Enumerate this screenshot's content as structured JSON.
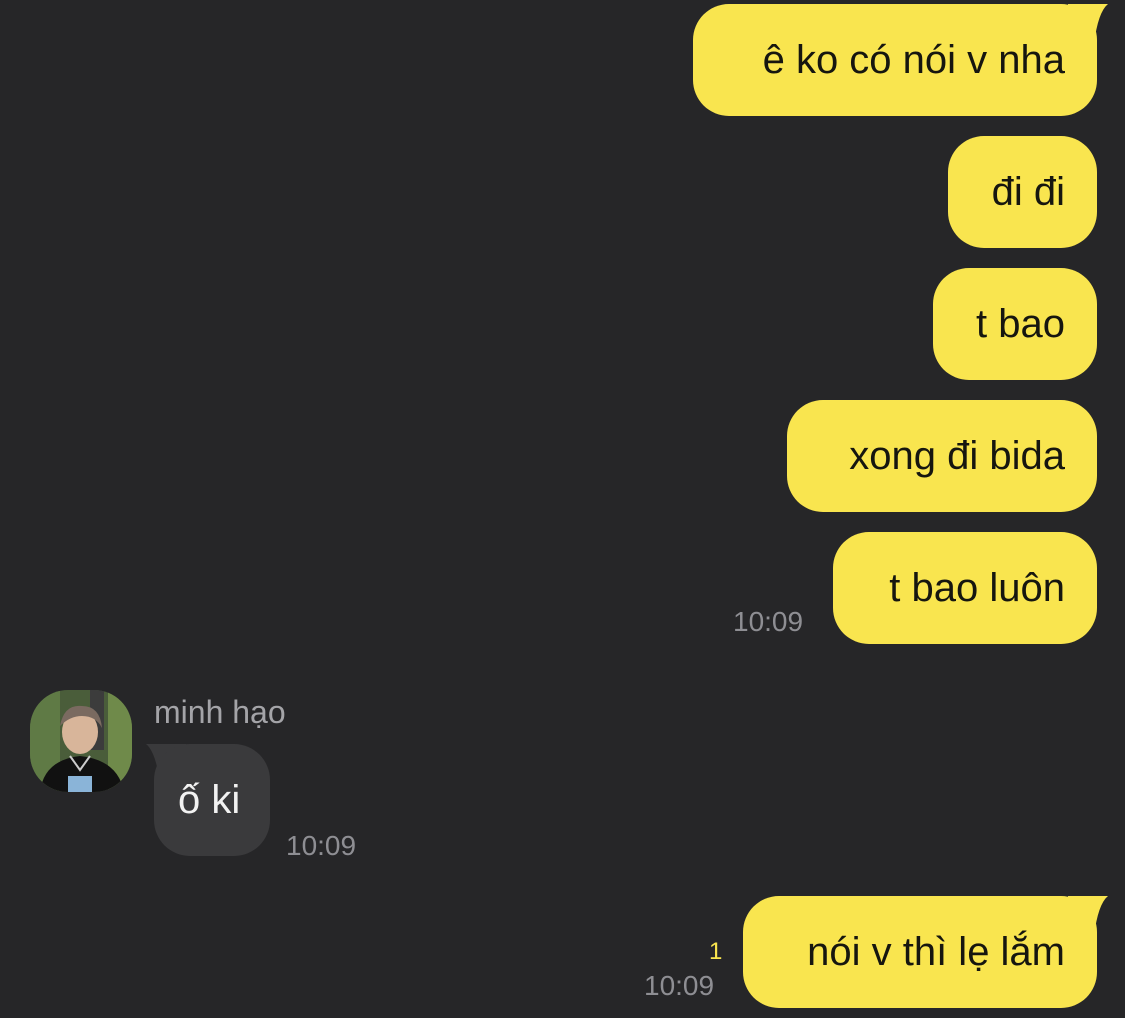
{
  "messages": [
    {
      "direction": "sent",
      "text": "ê ko có nói v nha"
    },
    {
      "direction": "sent",
      "text": "đi đi"
    },
    {
      "direction": "sent",
      "text": "t bao"
    },
    {
      "direction": "sent",
      "text": "xong đi bida"
    },
    {
      "direction": "sent",
      "text": "t bao luôn",
      "time": "10:09"
    },
    {
      "direction": "received",
      "sender": "minh hạo",
      "text": "ố ki",
      "time": "10:09"
    },
    {
      "direction": "sent",
      "text": "nói v thì lẹ lắm",
      "time": "10:09",
      "unread_count": "1"
    }
  ],
  "colors": {
    "background": "#262628",
    "sent_bubble": "#f9e54f",
    "received_bubble": "#3a3a3c",
    "timestamp": "#8e8e93",
    "unread_count": "#f9e54f"
  },
  "icons": {
    "avatar": "profile-photo"
  }
}
